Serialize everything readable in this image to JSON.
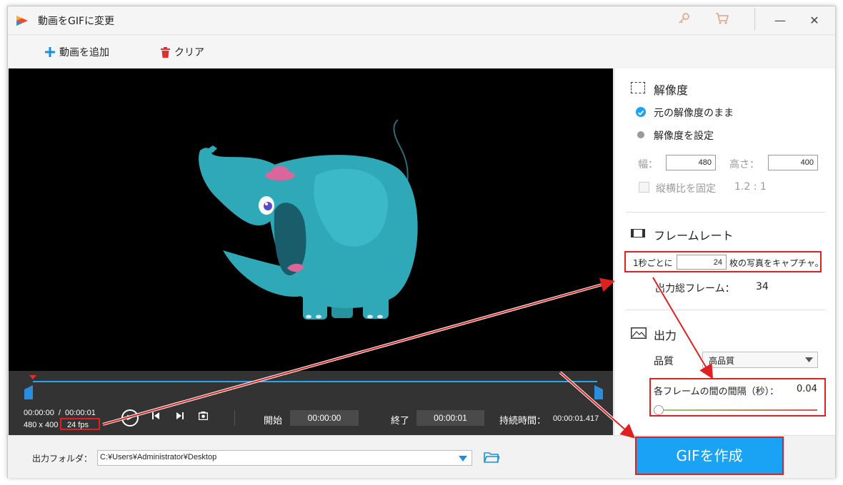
{
  "window": {
    "title": "動画をGIFに変更",
    "icons": [
      "key-icon",
      "cart-icon"
    ],
    "controls": {
      "minimize": "—",
      "close": "✕"
    }
  },
  "toolbar": {
    "add_video": "動画を追加",
    "clear": "クリア"
  },
  "timeline": {
    "current_time": "00:00:00",
    "separator": "/",
    "total_time": "00:00:01",
    "resolution": "480 x 400",
    "fps": "24 fps",
    "start_label": "開始",
    "start_value": "00:00:00",
    "end_label": "終了",
    "end_value": "00:00:01",
    "duration_label": "持続時間：",
    "duration_value": "00:00:01.417"
  },
  "panel": {
    "resolution": {
      "title": "解像度",
      "option_original": "元の解像度のまま",
      "option_custom": "解像度を設定",
      "selected": "original",
      "width_label": "幅：",
      "width_value": "480",
      "height_label": "高さ：",
      "height_value": "400",
      "lock_ratio_label": "縦横比を固定",
      "ratio": "1.2 : 1"
    },
    "framerate": {
      "title": "フレームレート",
      "prefix": "1秒ごとに",
      "value": "24",
      "suffix": "枚の写真をキャプチャ。",
      "total_label": "出力総フレーム：",
      "total_value": "34"
    },
    "output": {
      "title": "出力",
      "quality_label": "品質",
      "quality_value": "高品質",
      "interval_label": "各フレームの間の間隔（秒）：",
      "interval_value": "0.04",
      "interval_slider_level": 0.0
    }
  },
  "bottom": {
    "folder_label": "出力フォルダ：",
    "folder_path": "C:¥Users¥Administrator¥Desktop",
    "create_button": "GIFを作成"
  },
  "colors": {
    "accent": "#1aa3f5",
    "highlight_red": "#e02020",
    "elephant": "#2fa8b8",
    "hat": "#d9679a"
  }
}
